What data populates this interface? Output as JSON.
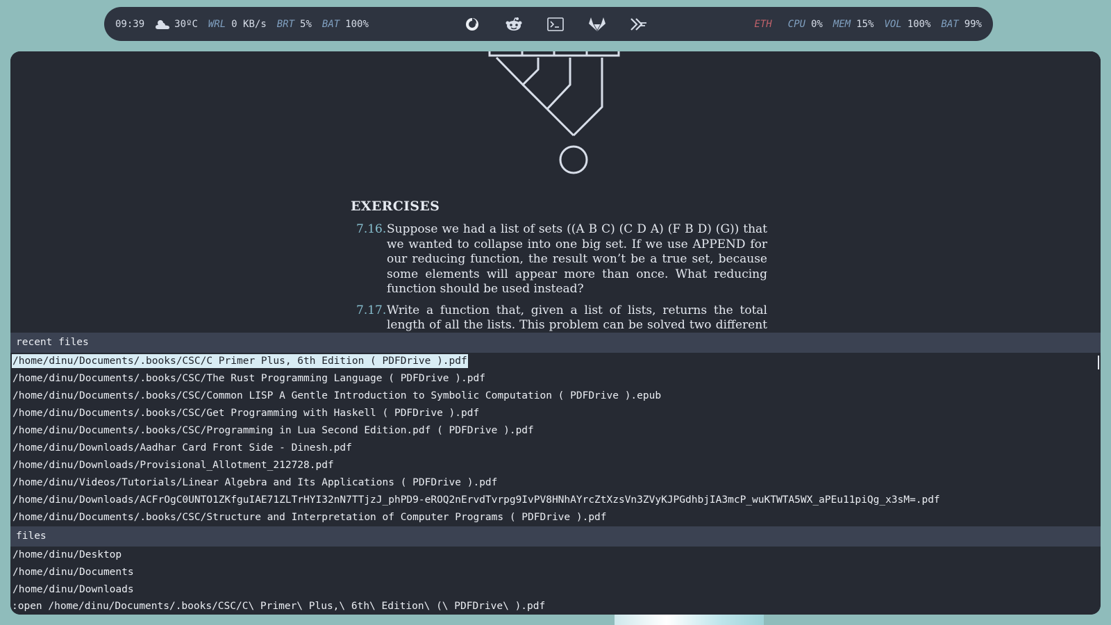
{
  "topbar": {
    "left": {
      "time": "09:39",
      "weather_icon": "cloud-sun-icon",
      "temp": "30ºC",
      "wrl_key": "WRL",
      "wrl_val": "0 KB/s",
      "brt_key": "BRT",
      "brt_val": "5%",
      "bat_key": "BAT",
      "bat_val": "100%"
    },
    "apps": [
      "firefox-icon",
      "reddit-icon",
      "terminal-icon",
      "gitlab-icon",
      "hyper-icon"
    ],
    "right": {
      "eth_key": "ETH",
      "cpu_key": "CPU",
      "cpu_val": "0%",
      "mem_key": "MEM",
      "mem_val": "15%",
      "vol_key": "VOL",
      "vol_val": "100%",
      "bat_key": "BAT",
      "bat_val": "99%"
    }
  },
  "document": {
    "heading": "EXERCISES",
    "exercises": [
      {
        "num": "7.16.",
        "text": "Suppose we had a list of sets ((A B C) (C D A) (F B D) (G)) that we wanted to collapse into one big set. If we use APPEND for our reducing function, the result won’t be a true set, because some elements will appear more than once. What reducing function should be used instead?"
      },
      {
        "num": "7.17.",
        "text": "Write a function that, given a list of lists, returns the total length of all the lists. This problem can be solved two different ways."
      }
    ]
  },
  "completion": {
    "recent_header": "recent files",
    "recent": [
      "/home/dinu/Documents/.books/CSC/C Primer Plus, 6th Edition ( PDFDrive ).pdf",
      "/home/dinu/Documents/.books/CSC/The Rust Programming Language ( PDFDrive ).pdf",
      "/home/dinu/Documents/.books/CSC/Common LISP A Gentle Introduction to Symbolic Computation ( PDFDrive ).epub",
      "/home/dinu/Documents/.books/CSC/Get Programming with Haskell ( PDFDrive ).pdf",
      "/home/dinu/Documents/.books/CSC/Programming in Lua Second Edition.pdf ( PDFDrive ).pdf",
      "/home/dinu/Downloads/Aadhar Card Front Side - Dinesh.pdf",
      "/home/dinu/Downloads/Provisional_Allotment_212728.pdf",
      "/home/dinu/Videos/Tutorials/Linear Algebra and Its Applications ( PDFDrive ).pdf",
      "/home/dinu/Downloads/ACFrOgC0UNTO1ZKfguIAE71ZLTrHYI32nN7TTjzJ_phPD9-eROQ2nErvdTvrpg9IvPV8HNhAYrcZtXzsVn3ZVyKJPGdhbjIA3mcP_wuKTWTA5WX_aPEu11piQg_x3sM=.pdf",
      "/home/dinu/Documents/.books/CSC/Structure and Interpretation of Computer Programs ( PDFDrive ).pdf"
    ],
    "files_header": "files",
    "files": [
      "/home/dinu/Desktop",
      "/home/dinu/Documents",
      "/home/dinu/Downloads"
    ],
    "command": ":open /home/dinu/Documents/.books/CSC/C\\ Primer\\ Plus,\\ 6th\\ Edition\\ (\\ PDFDrive\\ ).pdf"
  },
  "colors": {
    "desktop_bg": "#8fbcbb",
    "bar_bg": "#2e3440",
    "window_bg": "#262a33",
    "accent_key": "#81a1c1",
    "eth_key": "#bf616a",
    "selection_bg": "#d8ecf4"
  }
}
